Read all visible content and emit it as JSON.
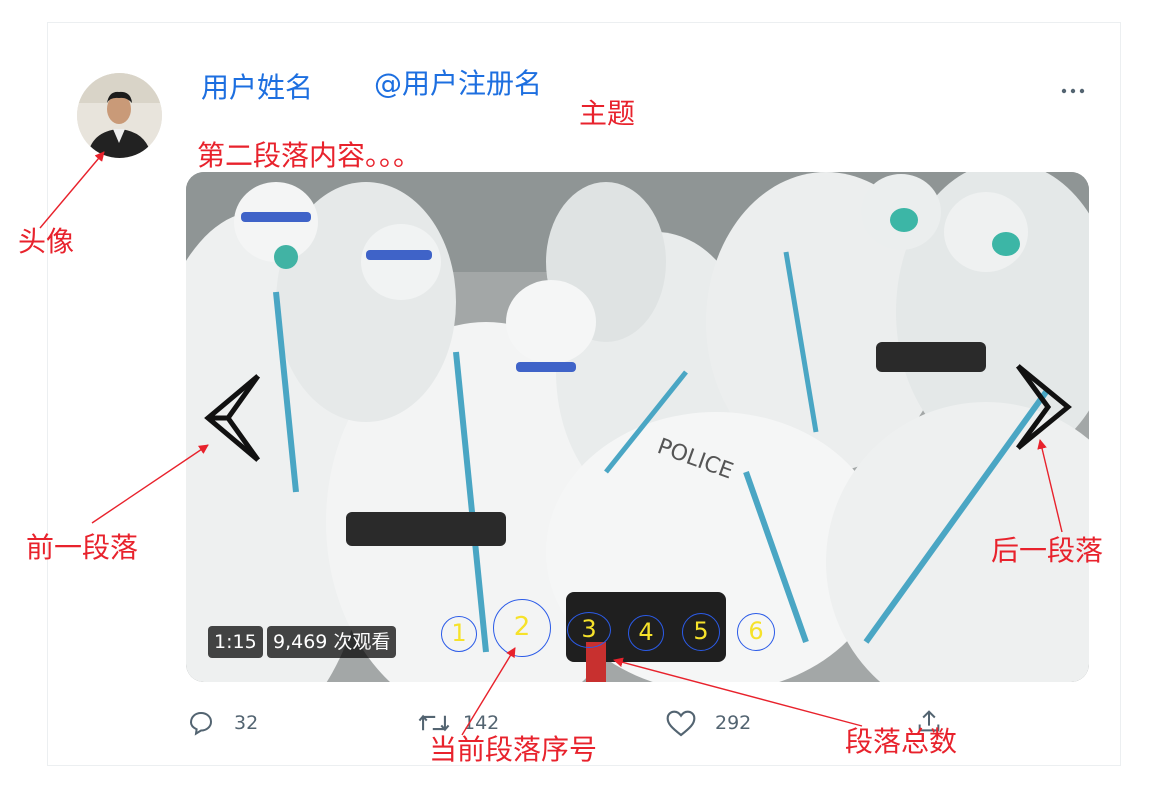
{
  "user": {
    "display_name": "用户姓名",
    "handle": "@用户注册名"
  },
  "labels": {
    "topic": "主题",
    "second_paragraph": "第二段落内容。。。",
    "avatar": "头像",
    "prev_paragraph": "前一段落",
    "next_paragraph": "后一段落",
    "current_index": "当前段落序号",
    "total_count": "段落总数"
  },
  "video": {
    "duration": "1:15",
    "views": "9,469 次观看"
  },
  "pagination": {
    "pages": [
      "1",
      "2",
      "3",
      "4",
      "5",
      "6"
    ],
    "current": 2
  },
  "actions": {
    "reply_count": "32",
    "retweet_count": "142",
    "like_count": "292"
  },
  "colors": {
    "blue_text": "#1d6fe0",
    "annotation_red": "#e8222c",
    "page_number_yellow": "#f6e22a",
    "page_circle_blue": "#2b5be8"
  },
  "icons": {
    "more": "more-horizontal-icon",
    "prev": "chevron-left-icon",
    "next": "chevron-right-icon",
    "reply": "reply-icon",
    "retweet": "retweet-icon",
    "like": "heart-icon",
    "share": "share-icon"
  }
}
